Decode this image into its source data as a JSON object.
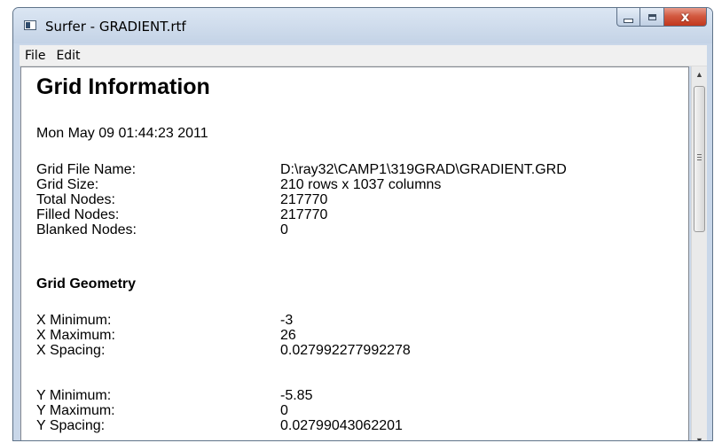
{
  "window": {
    "title": "Surfer - GRADIENT.rtf",
    "close_glyph": "x"
  },
  "menu": {
    "items": [
      "File",
      "Edit"
    ]
  },
  "document": {
    "title": "Grid Information",
    "date": "Mon May 09 01:44:23 2011",
    "grid_info": [
      {
        "label": "Grid File Name:",
        "value": "D:\\ray32\\CAMP1\\319GRAD\\GRADIENT.GRD"
      },
      {
        "label": "Grid Size:",
        "value": "210 rows x 1037 columns"
      },
      {
        "label": "Total Nodes:",
        "value": "217770"
      },
      {
        "label": "Filled Nodes:",
        "value": "217770"
      },
      {
        "label": "Blanked Nodes:",
        "value": "0"
      }
    ],
    "geometry_title": "Grid Geometry",
    "x_geometry": [
      {
        "label": "X Minimum:",
        "value": "-3"
      },
      {
        "label": "X Maximum:",
        "value": "26"
      },
      {
        "label": "X Spacing:",
        "value": "0.027992277992278"
      }
    ],
    "y_geometry": [
      {
        "label": "Y Minimum:",
        "value": "-5.85"
      },
      {
        "label": "Y Maximum:",
        "value": "0"
      },
      {
        "label": "Y Spacing:",
        "value": "0.02799043062201"
      }
    ]
  }
}
